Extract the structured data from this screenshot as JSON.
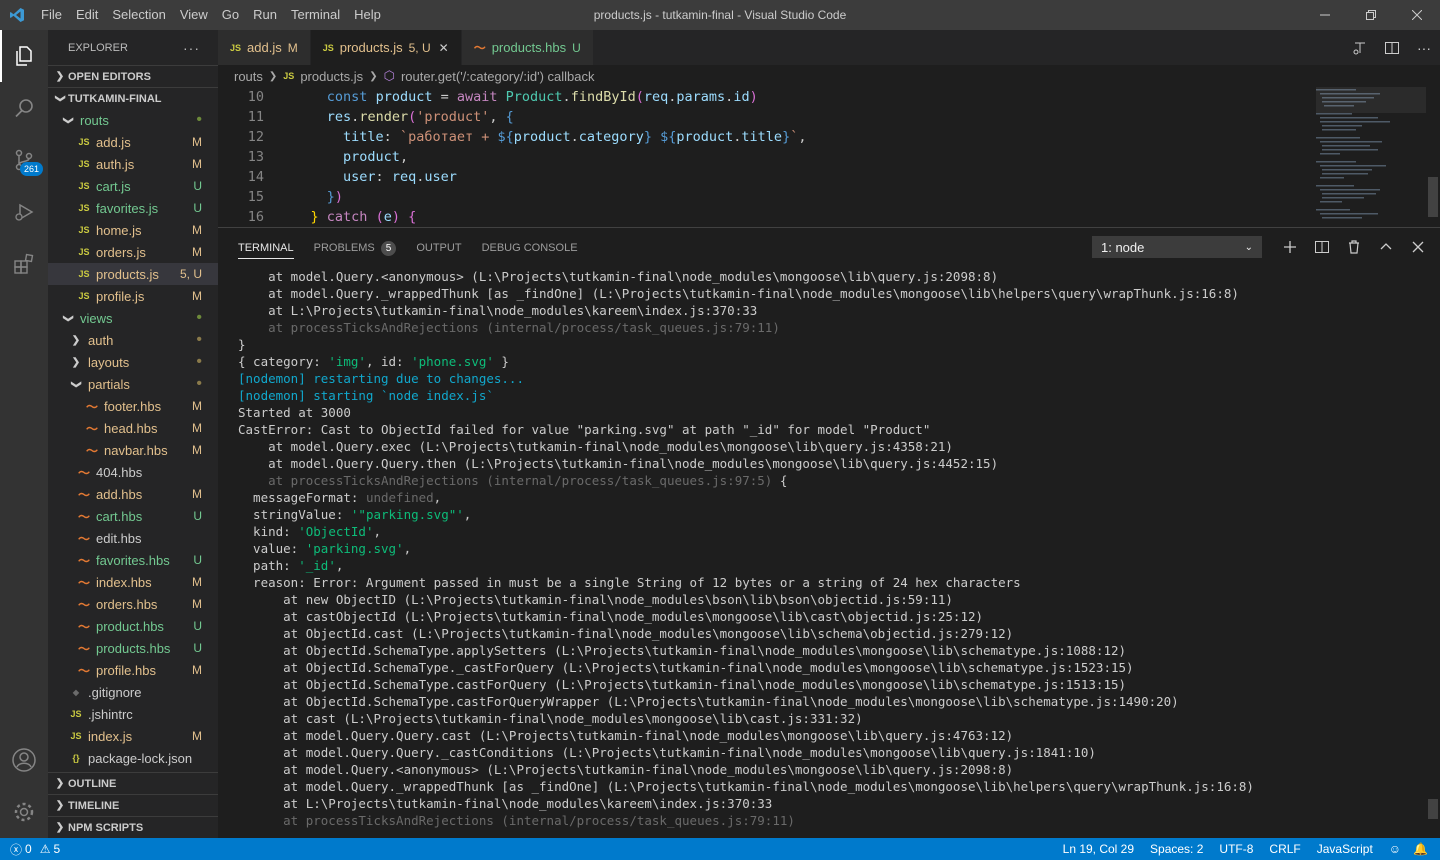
{
  "titlebar": {
    "menu": [
      "File",
      "Edit",
      "Selection",
      "View",
      "Go",
      "Run",
      "Terminal",
      "Help"
    ],
    "title": "products.js - tutkamin-final - Visual Studio Code"
  },
  "activity": {
    "scm_badge": "261"
  },
  "sidebar": {
    "header": "EXPLORER",
    "open_editors": "OPEN EDITORS",
    "project": "TUTKAMIN-FINAL",
    "outline": "OUTLINE",
    "timeline": "TIMELINE",
    "npm": "NPM SCRIPTS",
    "tree": [
      {
        "label": "routs",
        "type": "folder",
        "indent": 1,
        "status": "•",
        "color": "#73c991",
        "status_color": "#6d8a3a"
      },
      {
        "label": "add.js",
        "type": "js",
        "indent": 2,
        "status": "M",
        "color": "#e2c08d"
      },
      {
        "label": "auth.js",
        "type": "js",
        "indent": 2,
        "status": "M",
        "color": "#e2c08d"
      },
      {
        "label": "cart.js",
        "type": "js",
        "indent": 2,
        "status": "U",
        "color": "#73c991"
      },
      {
        "label": "favorites.js",
        "type": "js",
        "indent": 2,
        "status": "U",
        "color": "#73c991"
      },
      {
        "label": "home.js",
        "type": "js",
        "indent": 2,
        "status": "M",
        "color": "#e2c08d"
      },
      {
        "label": "orders.js",
        "type": "js",
        "indent": 2,
        "status": "M",
        "color": "#e2c08d"
      },
      {
        "label": "products.js",
        "type": "js",
        "indent": 2,
        "status": "5, U",
        "color": "#e2c08d",
        "selected": true
      },
      {
        "label": "profile.js",
        "type": "js",
        "indent": 2,
        "status": "M",
        "color": "#e2c08d"
      },
      {
        "label": "views",
        "type": "folder",
        "indent": 1,
        "status": "•",
        "color": "#73c991",
        "status_color": "#6d8a3a"
      },
      {
        "label": "auth",
        "type": "folderc",
        "indent": 2,
        "status": "•",
        "color": "#e2c08d",
        "status_color": "#8a7a4a"
      },
      {
        "label": "layouts",
        "type": "folderc",
        "indent": 2,
        "status": "•",
        "color": "#e2c08d",
        "status_color": "#8a7a4a"
      },
      {
        "label": "partials",
        "type": "folder",
        "indent": 2,
        "status": "•",
        "color": "#e2c08d",
        "status_color": "#8a7a4a"
      },
      {
        "label": "footer.hbs",
        "type": "hbs",
        "indent": 3,
        "status": "M",
        "color": "#e2c08d"
      },
      {
        "label": "head.hbs",
        "type": "hbs",
        "indent": 3,
        "status": "M",
        "color": "#e2c08d"
      },
      {
        "label": "navbar.hbs",
        "type": "hbs",
        "indent": 3,
        "status": "M",
        "color": "#e2c08d"
      },
      {
        "label": "404.hbs",
        "type": "hbs",
        "indent": 2,
        "status": "",
        "color": "#cccccc"
      },
      {
        "label": "add.hbs",
        "type": "hbs",
        "indent": 2,
        "status": "M",
        "color": "#e2c08d"
      },
      {
        "label": "cart.hbs",
        "type": "hbs",
        "indent": 2,
        "status": "U",
        "color": "#73c991"
      },
      {
        "label": "edit.hbs",
        "type": "hbs",
        "indent": 2,
        "status": "",
        "color": "#cccccc"
      },
      {
        "label": "favorites.hbs",
        "type": "hbs",
        "indent": 2,
        "status": "U",
        "color": "#73c991"
      },
      {
        "label": "index.hbs",
        "type": "hbs",
        "indent": 2,
        "status": "M",
        "color": "#e2c08d"
      },
      {
        "label": "orders.hbs",
        "type": "hbs",
        "indent": 2,
        "status": "M",
        "color": "#e2c08d"
      },
      {
        "label": "product.hbs",
        "type": "hbs",
        "indent": 2,
        "status": "U",
        "color": "#73c991"
      },
      {
        "label": "products.hbs",
        "type": "hbs",
        "indent": 2,
        "status": "U",
        "color": "#73c991"
      },
      {
        "label": "profile.hbs",
        "type": "hbs",
        "indent": 2,
        "status": "M",
        "color": "#e2c08d"
      },
      {
        "label": ".gitignore",
        "type": "git",
        "indent": 1,
        "status": "",
        "color": "#cccccc"
      },
      {
        "label": ".jshintrc",
        "type": "js",
        "indent": 1,
        "status": "",
        "color": "#cccccc"
      },
      {
        "label": "index.js",
        "type": "js",
        "indent": 1,
        "status": "M",
        "color": "#e2c08d"
      },
      {
        "label": "package-lock.json",
        "type": "json",
        "indent": 1,
        "status": "",
        "color": "#cccccc"
      }
    ]
  },
  "tabs": [
    {
      "label": "add.js",
      "status": "M",
      "icon": "JS",
      "active": false,
      "color": "#e2c08d"
    },
    {
      "label": "products.js",
      "status": "5, U",
      "icon": "JS",
      "active": true,
      "color": "#e2c08d"
    },
    {
      "label": "products.hbs",
      "status": "U",
      "icon": "hbs",
      "active": false,
      "color": "#73c991"
    }
  ],
  "breadcrumb": [
    "routs",
    "products.js",
    "router.get('/:category/:id') callback"
  ],
  "code_lines": [
    {
      "n": "10",
      "html": "      <span class=\"kw\">const</span> <span class=\"vr\">product</span> = <span class=\"kw2\">await</span> <span class=\"cls\">Product</span>.<span class=\"fn\">findById</span><span class=\"pn2\">(</span><span class=\"vr\">req</span>.<span class=\"vr\">params</span>.<span class=\"vr\">id</span><span class=\"pn2\">)</span>"
    },
    {
      "n": "11",
      "html": "      <span class=\"vr\">res</span>.<span class=\"fn\">render</span><span class=\"pn2\">(</span><span class=\"str\">'product'</span>, <span class=\"kw\">{</span>"
    },
    {
      "n": "12",
      "html": "        <span class=\"vr\">title</span>: <span class=\"str\">`работает + </span><span class=\"kw\">${</span><span class=\"vr\">product</span>.<span class=\"vr\">category</span><span class=\"kw\">}</span><span class=\"str\"> </span><span class=\"kw\">${</span><span class=\"vr\">product</span>.<span class=\"vr\">title</span><span class=\"kw\">}</span><span class=\"str\">`</span>,"
    },
    {
      "n": "13",
      "html": "        <span class=\"vr\">product</span>,"
    },
    {
      "n": "14",
      "html": "        <span class=\"vr\">user</span>: <span class=\"vr\">req</span>.<span class=\"vr\">user</span>"
    },
    {
      "n": "15",
      "html": "      <span class=\"kw\">}</span><span class=\"pn2\">)</span>"
    },
    {
      "n": "16",
      "html": "    <span class=\"pn\">}</span> <span class=\"kw2\">catch</span> <span class=\"pn2\">(</span><span class=\"vr\">e</span><span class=\"pn2\">)</span> <span class=\"pn2\">{</span>"
    }
  ],
  "panel": {
    "tabs": [
      "TERMINAL",
      "PROBLEMS",
      "OUTPUT",
      "DEBUG CONSOLE"
    ],
    "problems_count": "5",
    "terminal_select": "1: node"
  },
  "terminal_lines": [
    "    at model.Query.<anonymous> (L:\\Projects\\tutkamin-final\\node_modules\\mongoose\\lib\\query.js:2098:8)",
    "    at model.Query._wrappedThunk [as _findOne] (L:\\Projects\\tutkamin-final\\node_modules\\mongoose\\lib\\helpers\\query\\wrapThunk.js:16:8)",
    "    at L:\\Projects\\tutkamin-final\\node_modules\\kareem\\index.js:370:33",
    "%dim%    at processTicksAndRejections (internal/process/task_queues.js:79:11)",
    "}",
    "%cat%",
    "%nm%[nodemon] restarting due to changes...",
    "%nm%[nodemon] starting `node index.js`",
    "Started at 3000",
    "CastError: Cast to ObjectId failed for value \"parking.svg\" at path \"_id\" for model \"Product\"",
    "    at model.Query.exec (L:\\Projects\\tutkamin-final\\node_modules\\mongoose\\lib\\query.js:4358:21)",
    "    at model.Query.Query.then (L:\\Projects\\tutkamin-final\\node_modules\\mongoose\\lib\\query.js:4452:15)",
    "%dimb%    at processTicksAndRejections (internal/process/task_queues.js:97:5)",
    "%mf%",
    "%sv%",
    "%kind%",
    "%val%",
    "%path%",
    "  reason: Error: Argument passed in must be a single String of 12 bytes or a string of 24 hex characters",
    "      at new ObjectID (L:\\Projects\\tutkamin-final\\node_modules\\bson\\lib\\bson\\objectid.js:59:11)",
    "      at castObjectId (L:\\Projects\\tutkamin-final\\node_modules\\mongoose\\lib\\cast\\objectid.js:25:12)",
    "      at ObjectId.cast (L:\\Projects\\tutkamin-final\\node_modules\\mongoose\\lib\\schema\\objectid.js:279:12)",
    "      at ObjectId.SchemaType.applySetters (L:\\Projects\\tutkamin-final\\node_modules\\mongoose\\lib\\schematype.js:1088:12)",
    "      at ObjectId.SchemaType._castForQuery (L:\\Projects\\tutkamin-final\\node_modules\\mongoose\\lib\\schematype.js:1523:15)",
    "      at ObjectId.SchemaType.castForQuery (L:\\Projects\\tutkamin-final\\node_modules\\mongoose\\lib\\schematype.js:1513:15)",
    "      at ObjectId.SchemaType.castForQueryWrapper (L:\\Projects\\tutkamin-final\\node_modules\\mongoose\\lib\\schematype.js:1490:20)",
    "      at cast (L:\\Projects\\tutkamin-final\\node_modules\\mongoose\\lib\\cast.js:331:32)",
    "      at model.Query.Query.cast (L:\\Projects\\tutkamin-final\\node_modules\\mongoose\\lib\\query.js:4763:12)",
    "      at model.Query.Query._castConditions (L:\\Projects\\tutkamin-final\\node_modules\\mongoose\\lib\\query.js:1841:10)",
    "      at model.Query.<anonymous> (L:\\Projects\\tutkamin-final\\node_modules\\mongoose\\lib\\query.js:2098:8)",
    "      at model.Query._wrappedThunk [as _findOne] (L:\\Projects\\tutkamin-final\\node_modules\\mongoose\\lib\\helpers\\query\\wrapThunk.js:16:8)",
    "      at L:\\Projects\\tutkamin-final\\node_modules\\kareem\\index.js:370:33",
    "%dim%      at processTicksAndRejections (internal/process/task_queues.js:79:11)"
  ],
  "status": {
    "errors": "0",
    "warnings": "5",
    "position": "Ln 19, Col 29",
    "spaces": "Spaces: 2",
    "encoding": "UTF-8",
    "eol": "CRLF",
    "language": "JavaScript"
  }
}
